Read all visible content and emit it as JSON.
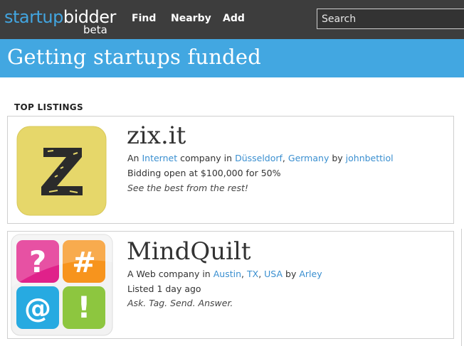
{
  "header": {
    "logo_part1": "startup",
    "logo_part2": "bidder",
    "logo_badge": "beta",
    "nav": {
      "find": "Find",
      "nearby": "Nearby",
      "add": "Add"
    },
    "search_placeholder": "Search"
  },
  "banner": {
    "title": "Getting startups funded"
  },
  "listings": {
    "section_title": "TOP LISTINGS",
    "items": [
      {
        "name": "zix.it",
        "logo_icon": "zix-z-logo",
        "desc_prefix": "An",
        "category": "Internet",
        "company_word": "company in",
        "city": "Düsseldorf",
        "comma": ",",
        "country": "Germany",
        "by_word": "by",
        "owner": "johnbettiol",
        "status": "Bidding open at $100,000 for 50%",
        "tagline": "See the best from the rest!"
      },
      {
        "name": "MindQuilt",
        "logo_icon": "mindquilt-tiles-logo",
        "desc_prefix": "A Web company in",
        "city": "Austin",
        "comma1": ",",
        "state": "TX",
        "comma2": ",",
        "country": "USA",
        "by_word": "by",
        "owner": "Arley",
        "status": "Listed 1 day ago",
        "tagline": "Ask. Tag. Send. Answer."
      }
    ]
  },
  "colors": {
    "topbar": "#3d3d3d",
    "brand_blue": "#42a7e1",
    "link": "#3a8fd0",
    "zix_yellow": "#e6d76a",
    "tile_pink": "#e0218a",
    "tile_orange": "#f7941d",
    "tile_cyan": "#27aae1",
    "tile_green": "#8dc63f"
  }
}
